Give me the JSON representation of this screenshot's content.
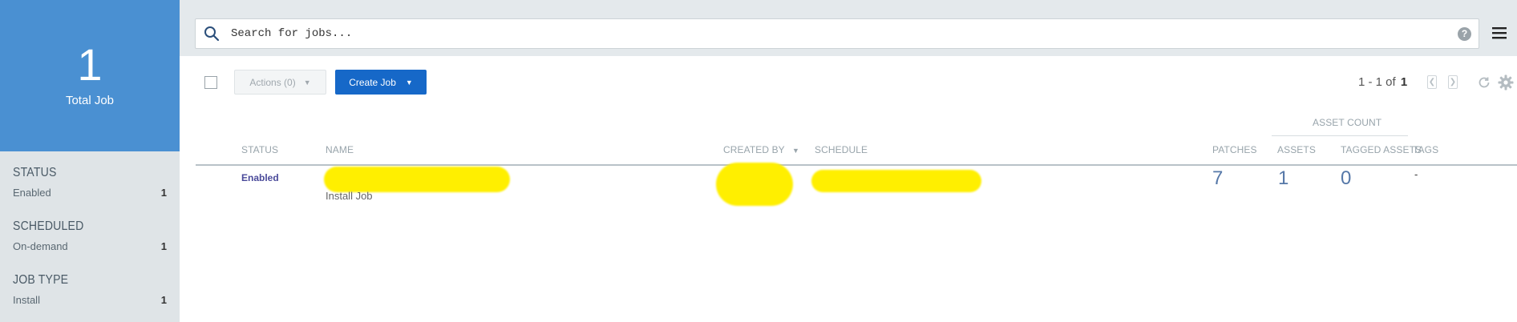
{
  "summary": {
    "count": "1",
    "label": "Total Job"
  },
  "filters": [
    {
      "title": "STATUS",
      "option": "Enabled",
      "count": "1"
    },
    {
      "title": "SCHEDULED",
      "option": "On-demand",
      "count": "1"
    },
    {
      "title": "JOB TYPE",
      "option": "Install",
      "count": "1"
    }
  ],
  "search": {
    "placeholder": "Search for jobs...",
    "value": ""
  },
  "toolbar": {
    "actions_label": "Actions (0)",
    "create_label": "Create Job",
    "pagination_range": "1 - 1 of",
    "pagination_total": "1"
  },
  "table": {
    "group_header": "ASSET COUNT",
    "columns": {
      "status": "STATUS",
      "name": "NAME",
      "created_by": "CREATED BY",
      "schedule": "SCHEDULE",
      "patches": "PATCHES",
      "assets": "ASSETS",
      "tagged_assets": "TAGGED ASSETS",
      "tags": "TAGS"
    },
    "sort_indicator": "▼",
    "rows": [
      {
        "status": "Enabled",
        "job_type": "Install Job",
        "patches": "7",
        "assets": "1",
        "tagged_assets": "0",
        "tags": "-"
      }
    ]
  },
  "colors": {
    "accent": "#4a90d2",
    "primary_button": "#1668c8",
    "redaction": "#ffef00"
  }
}
